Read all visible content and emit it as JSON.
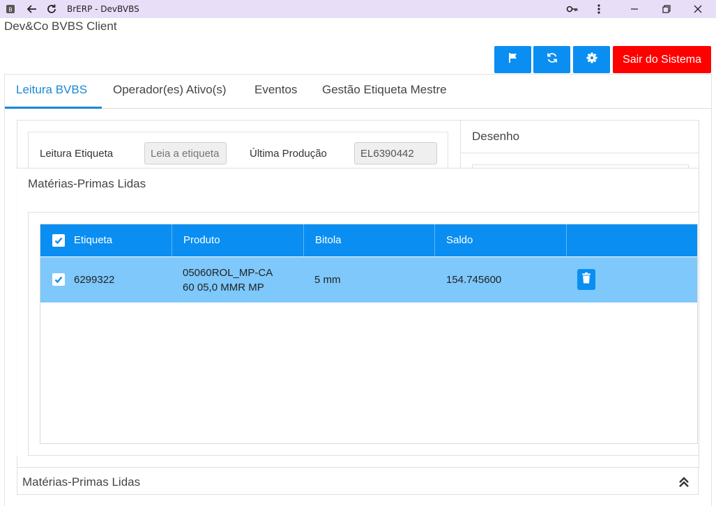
{
  "window": {
    "title": "BrERP - DevBVBS",
    "icons": [
      "app-icon",
      "back-icon",
      "reload-icon",
      "key-icon",
      "more-icon",
      "minimize-icon",
      "maximize-icon",
      "close-icon"
    ]
  },
  "app": {
    "title": "Dev&Co BVBS Client"
  },
  "header": {
    "buttons": [
      "flag-icon",
      "refresh-icon",
      "gear-icon"
    ],
    "exit_label": "Sair do Sistema",
    "accent": "#0a8ef2",
    "exit_color": "#ff0000"
  },
  "tabs": [
    {
      "label": "Leitura BVBS",
      "active": true
    },
    {
      "label": "Operador(es) Ativo(s)",
      "active": false
    },
    {
      "label": "Eventos",
      "active": false
    },
    {
      "label": "Gestão Etiqueta Mestre",
      "active": false
    }
  ],
  "leitura": {
    "label": "Leitura Etiqueta",
    "placeholder": "Leia a etiqueta",
    "ultima_label": "Última Produção",
    "ultima_value": "EL6390442"
  },
  "desenho": {
    "title": "Desenho"
  },
  "materias": {
    "title": "Matérias-Primas Lidas",
    "columns": [
      "Etiqueta",
      "Produto",
      "Bitola",
      "Saldo",
      ""
    ],
    "rows": [
      {
        "checked": true,
        "etiqueta": "6299322",
        "produto_line1": "05060ROL_MP-CA",
        "produto_line2": "60 05,0 MMR MP",
        "bitola": "5 mm",
        "saldo": "154.745600"
      }
    ]
  },
  "footer": {
    "title": "Matérias-Primas Lidas",
    "icon": "chevron-double-up-icon"
  }
}
